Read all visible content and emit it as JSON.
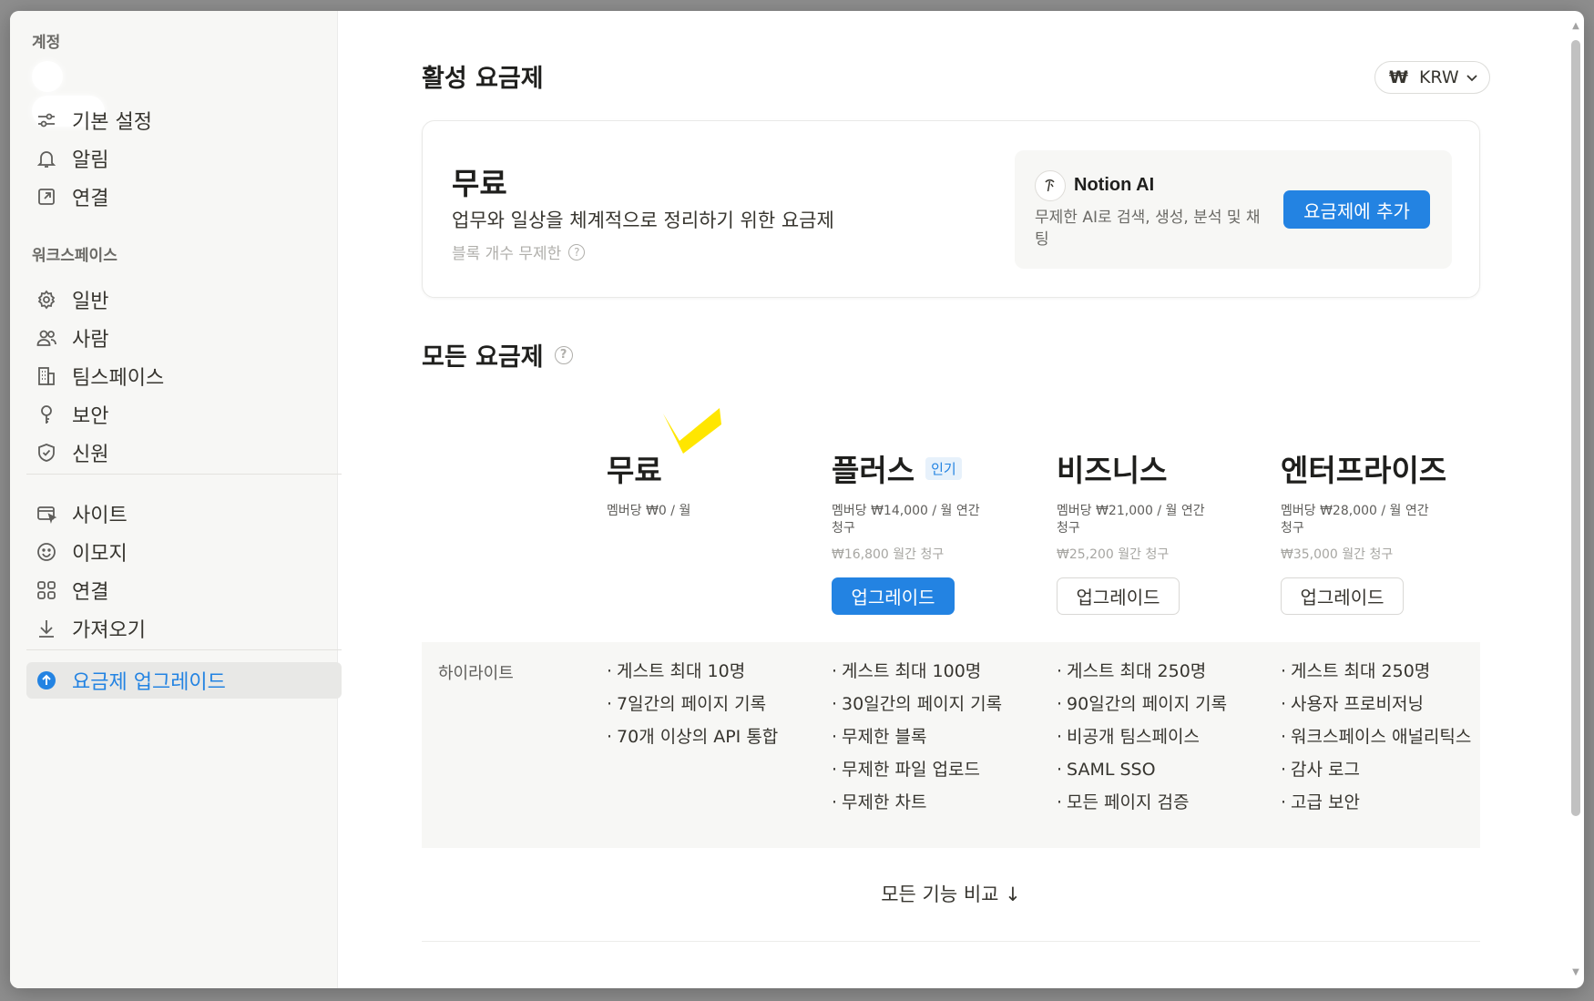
{
  "sidebar": {
    "account_heading": "계정",
    "account_items": [
      {
        "label": "기본 설정",
        "icon": "sliders-icon"
      },
      {
        "label": "알림",
        "icon": "bell-icon"
      },
      {
        "label": "연결",
        "icon": "external-link-icon"
      }
    ],
    "workspace_heading": "워크스페이스",
    "workspace_items": [
      {
        "label": "일반",
        "icon": "gear-icon"
      },
      {
        "label": "사람",
        "icon": "people-icon"
      },
      {
        "label": "팀스페이스",
        "icon": "building-icon"
      },
      {
        "label": "보안",
        "icon": "key-icon"
      },
      {
        "label": "신원",
        "icon": "shield-icon"
      }
    ],
    "other_items": [
      {
        "label": "사이트",
        "icon": "site-icon"
      },
      {
        "label": "이모지",
        "icon": "smile-icon"
      },
      {
        "label": "연결",
        "icon": "grid-icon"
      },
      {
        "label": "가져오기",
        "icon": "download-icon"
      }
    ],
    "upgrade_label": "요금제 업그레이드"
  },
  "active_plan": {
    "heading": "활성 요금제",
    "currency_symbol": "₩",
    "currency": "KRW",
    "name": "무료",
    "description": "업무와 일상을 체계적으로 정리하기 위한 요금제",
    "sub": "블록 개수 무제한",
    "addon": {
      "name": "Notion AI",
      "description": "무제한 AI로 검색, 생성, 분석 및 채팅",
      "button": "요금제에 추가"
    }
  },
  "all_plans": {
    "heading": "모든 요금제",
    "plans": [
      {
        "name": "무료",
        "badge": "",
        "price": "멤버당 ₩0 / 월",
        "monthly": "",
        "button": ""
      },
      {
        "name": "플러스",
        "badge": "인기",
        "price": "멤버당 ₩14,000 / 월 연간 청구",
        "monthly": "₩16,800 월간 청구",
        "button": "업그레이드"
      },
      {
        "name": "비즈니스",
        "badge": "",
        "price": "멤버당 ₩21,000 / 월 연간 청구",
        "monthly": "₩25,200 월간 청구",
        "button": "업그레이드"
      },
      {
        "name": "엔터프라이즈",
        "badge": "",
        "price": "멤버당 ₩28,000 / 월 연간 청구",
        "monthly": "₩35,000 월간 청구",
        "button": "업그레이드"
      }
    ],
    "highlights_label": "하이라이트",
    "highlights": [
      [
        "게스트 최대 10명",
        "7일간의 페이지 기록",
        "70개 이상의 API 통합"
      ],
      [
        "게스트 최대 100명",
        "30일간의 페이지 기록",
        "무제한 블록",
        "무제한 파일 업로드",
        "무제한 차트"
      ],
      [
        "게스트 최대 250명",
        "90일간의 페이지 기록",
        "비공개 팀스페이스",
        "SAML SSO",
        "모든 페이지 검증"
      ],
      [
        "게스트 최대 250명",
        "사용자 프로비저닝",
        "워크스페이스 애널리틱스",
        "감사 로그",
        "고급 보안"
      ]
    ],
    "compare_label": "모든 기능 비교 ↓"
  },
  "colors": {
    "accent": "#2383e2",
    "highlight_mark": "#ffe600"
  }
}
